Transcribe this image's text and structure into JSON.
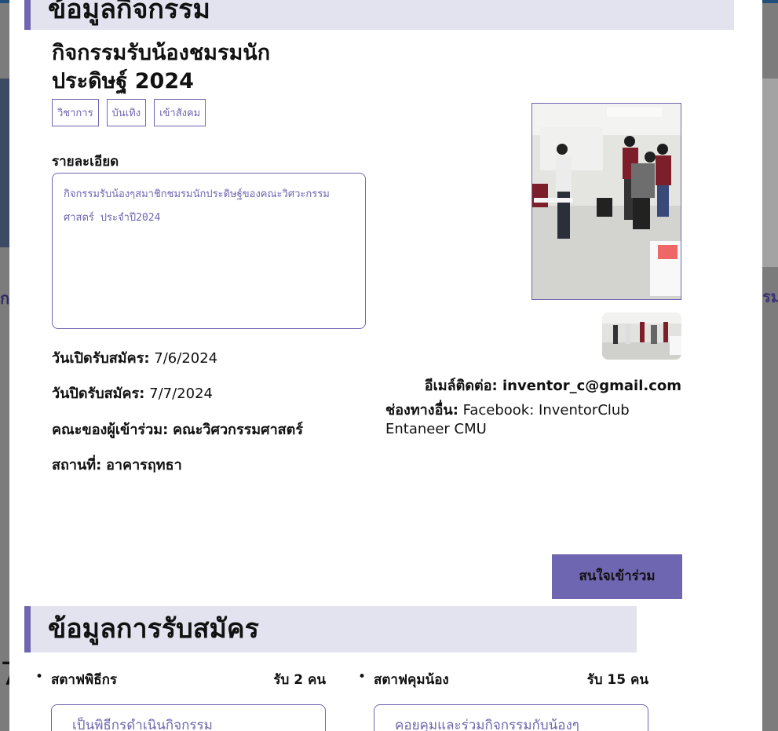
{
  "background": {
    "left_partial_text": "ก",
    "right_partial_text": "รม",
    "left_big_text": "7"
  },
  "activity_section": {
    "header": "ข้อมูลกิจกรรม",
    "title": "กิจกรรมรับน้องชมรมนักประดิษฐ์ 2024",
    "tags": [
      "วิชาการ",
      "บันเทิง",
      "เข้าสังคม"
    ],
    "detail_label": "รายละเอียด",
    "detail_text": "กิจกรรมรับน้องๆสมาชิกชมรมนักประดิษฐ์ของคณะวิศวะกรรมศาสตร์ ประจำปี2024",
    "open_date_label": "วันเปิดรับสมัคร:",
    "open_date": "7/6/2024",
    "close_date_label": "วันปิดรับสมัคร:",
    "close_date": "7/7/2024",
    "faculty_label": "คณะของผู้เข้าร่วม:",
    "faculty": "คณะวิศวกรรมศาสตร์",
    "location_label": "สถานที่:",
    "location": "อาคารฤทธา",
    "email_label": "อีเมล์ติดต่อ:",
    "email": "inventor_c@gmail.com",
    "other_label": "ช่องทางอื่น:",
    "other": "Facebook: InventorClub Entaneer CMU",
    "join_button": "สนใจเข้าร่วม"
  },
  "registration_section": {
    "header": "ข้อมูลการรับสมัคร",
    "roles": [
      {
        "name": "สตาฟพิธีกร",
        "count": "รับ 2 คน",
        "description": "เป็นพิธีกรดำเนินกิจกรรม"
      },
      {
        "name": "สตาฟคุมน้อง",
        "count": "รับ 15 คน",
        "description": "คอยคุมและร่วมกิจกรรมกับน้องๆ"
      }
    ]
  },
  "colors": {
    "accent": "#6e66b0",
    "header_bg": "#e3e2ef",
    "top_bar": "#1f4f7a"
  }
}
